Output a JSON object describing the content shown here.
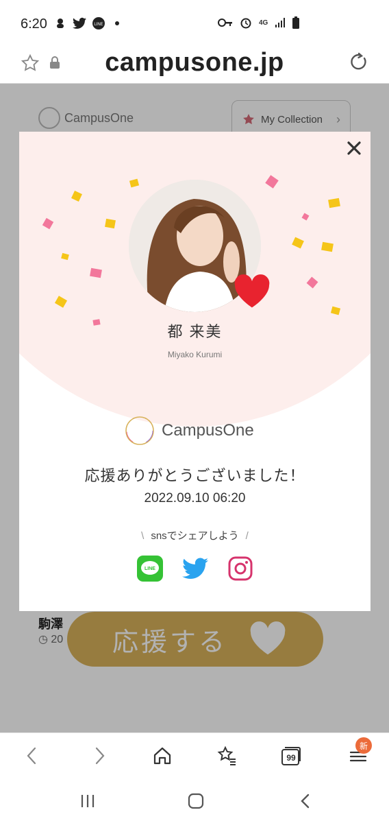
{
  "status_bar": {
    "time": "6:20",
    "network": "4G"
  },
  "url_bar": {
    "domain": "campusone.jp"
  },
  "background_page": {
    "logo_text": "CampusOne",
    "collection_label": "My Collection",
    "name_partial": "駒澤",
    "date_partial": "20",
    "support_button_label": "応援する"
  },
  "modal": {
    "name": "都 来美",
    "name_roman": "Miyako Kurumi",
    "brand": "CampusOne",
    "thanks_message": "応援ありがとうございました！",
    "datetime": "2022.09.10 06:20",
    "share_label": "snsでシェアしよう",
    "share_services": [
      "LINE",
      "Twitter",
      "Instagram"
    ]
  },
  "toolbar": {
    "badge": "新",
    "tabs_count": "99"
  },
  "colors": {
    "accent_gold": "#d8b25b",
    "heart_red": "#e8232f",
    "modal_pink": "#fdeeec"
  }
}
